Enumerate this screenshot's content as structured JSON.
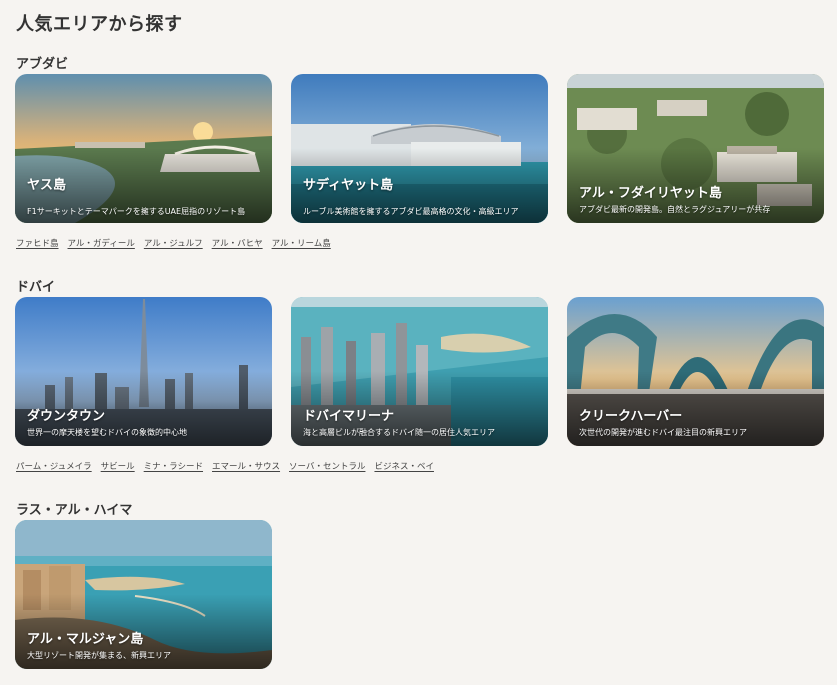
{
  "page_title": "人気エリアから探す",
  "regions": [
    {
      "title": "アブダビ",
      "cards": [
        {
          "name": "ヤス島",
          "desc": "F1サーキットとテーマパークを擁するUAE屈指のリゾート島"
        },
        {
          "name": "サディヤット島",
          "desc": "ルーブル美術館を擁するアブダビ最高格の文化・高級エリア"
        },
        {
          "name": "アル・フダイリヤット島",
          "desc": "アブダビ最新の開発島。自然とラグジュアリーが共存"
        }
      ],
      "links": [
        "ファヒド島",
        "アル・ガディール",
        "アル・ジュルフ",
        "アル・バヒヤ",
        "アル・リーム島"
      ]
    },
    {
      "title": "ドバイ",
      "cards": [
        {
          "name": "ダウンタウン",
          "desc": "世界一の摩天楼を望むドバイの象徴的中心地"
        },
        {
          "name": "ドバイマリーナ",
          "desc": "海と高層ビルが融合するドバイ随一の居住人気エリア"
        },
        {
          "name": "クリークハーバー",
          "desc": "次世代の開発が進むドバイ最注目の新興エリア"
        }
      ],
      "links": [
        "パーム・ジュメイラ",
        "サビール",
        "ミナ・ラシード",
        "エマール・サウス",
        "ソーバ・セントラル",
        "ビジネス・ベイ"
      ]
    },
    {
      "title": "ラス・アル・ハイマ",
      "cards": [
        {
          "name": "アル・マルジャン島",
          "desc": "大型リゾート開発が集まる、新興エリア"
        }
      ],
      "links": []
    }
  ]
}
